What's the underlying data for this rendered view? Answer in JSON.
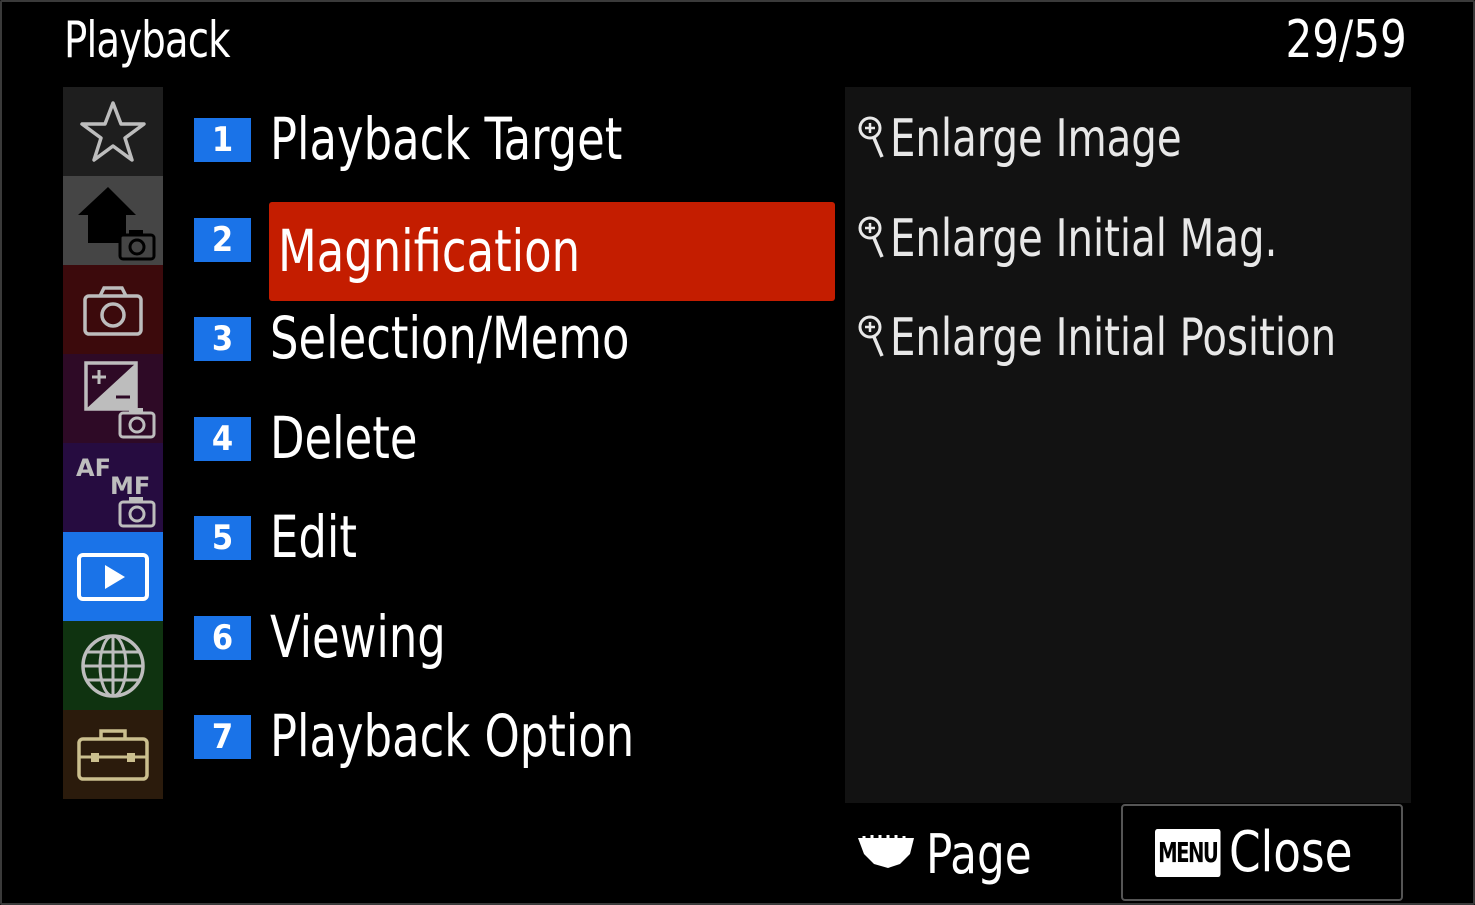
{
  "header": {
    "title": "Playback",
    "page_indicator": "29/59"
  },
  "categories": [
    {
      "id": "favorites",
      "icon": "star-icon",
      "color": "#1e1e1e"
    },
    {
      "id": "main-camera",
      "icon": "home-camera-icon",
      "color": "#454545"
    },
    {
      "id": "shooting",
      "icon": "camera-icon",
      "color": "#3c0a0c"
    },
    {
      "id": "exposure-color",
      "icon": "exposure-camera-icon",
      "color": "#2e0a26"
    },
    {
      "id": "focus",
      "icon": "af-mf-camera-icon",
      "af_text": "AF",
      "mf_text": "MF",
      "color": "#260c40"
    },
    {
      "id": "playback",
      "icon": "playback-icon",
      "color": "#1a73e8",
      "active": true
    },
    {
      "id": "network",
      "icon": "globe-icon",
      "color": "#0f3310"
    },
    {
      "id": "setup",
      "icon": "toolbox-icon",
      "color": "#2b1b0c"
    }
  ],
  "menu": {
    "selected_index": 1,
    "highlight_color": "#c41d00",
    "number_color": "#1a73e8",
    "items": [
      {
        "num": "1",
        "label": "Playback Target"
      },
      {
        "num": "2",
        "label": "Magnification"
      },
      {
        "num": "3",
        "label": "Selection/Memo"
      },
      {
        "num": "4",
        "label": "Delete"
      },
      {
        "num": "5",
        "label": "Edit"
      },
      {
        "num": "6",
        "label": "Viewing"
      },
      {
        "num": "7",
        "label": "Playback Option"
      }
    ]
  },
  "submenu": {
    "items": [
      {
        "icon": "magnify-plus-icon",
        "label": "Enlarge Image"
      },
      {
        "icon": "magnify-plus-icon",
        "label": "Enlarge Initial Mag."
      },
      {
        "icon": "magnify-plus-icon",
        "label": "Enlarge Initial Position"
      }
    ]
  },
  "footer": {
    "page_label": "Page",
    "page_icon": "dial-icon",
    "menu_key": "MENU",
    "close_label": "Close"
  }
}
